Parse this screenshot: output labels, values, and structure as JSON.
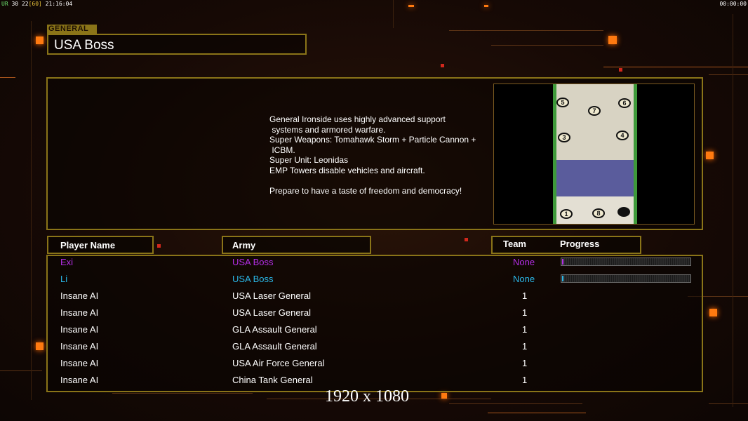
{
  "hud": {
    "left_fps_label": "UR",
    "left_fps": "30",
    "left_frame": "22",
    "left_target": "[60]",
    "left_clock": "21:16:04",
    "right_clock": "00:00:00"
  },
  "general": {
    "tag": "GENERAL",
    "name": "USA Boss",
    "description": "General Ironside uses highly advanced support\n systems and armored warfare.\nSuper Weapons: Tomahawk Storm + Particle Cannon +\n ICBM.\nSuper Unit: Leonidas\nEMP Towers disable vehicles and aircraft.\n\nPrepare to have a taste of freedom and democracy!"
  },
  "map": {
    "start_positions": [
      "5",
      "7",
      "6",
      "3",
      "4",
      "1",
      "8",
      ""
    ]
  },
  "table": {
    "headers": {
      "player_name": "Player Name",
      "army": "Army",
      "team": "Team",
      "progress": "Progress"
    },
    "rows": [
      {
        "name": "Exi",
        "army": "USA Boss",
        "team": "None",
        "progress": 0.01,
        "color": "#b42ee6"
      },
      {
        "name": "Li",
        "army": "USA Boss",
        "team": "None",
        "progress": 0.01,
        "color": "#2ab6e6"
      },
      {
        "name": "Insane AI",
        "army": "USA Laser General",
        "team": "1"
      },
      {
        "name": "Insane AI",
        "army": "USA Laser General",
        "team": "1"
      },
      {
        "name": "Insane AI",
        "army": "GLA Assault General",
        "team": "1"
      },
      {
        "name": "Insane AI",
        "army": "GLA Assault General",
        "team": "1"
      },
      {
        "name": "Insane AI",
        "army": "USA Air Force General",
        "team": "1"
      },
      {
        "name": "Insane AI",
        "army": "China Tank General",
        "team": "1"
      }
    ]
  },
  "resolution_label": "1920 x 1080",
  "colors": {
    "frame": "#8a7418",
    "accent_orange": "#ff7a10",
    "player1": "#b42ee6",
    "player2": "#2ab6e6"
  }
}
